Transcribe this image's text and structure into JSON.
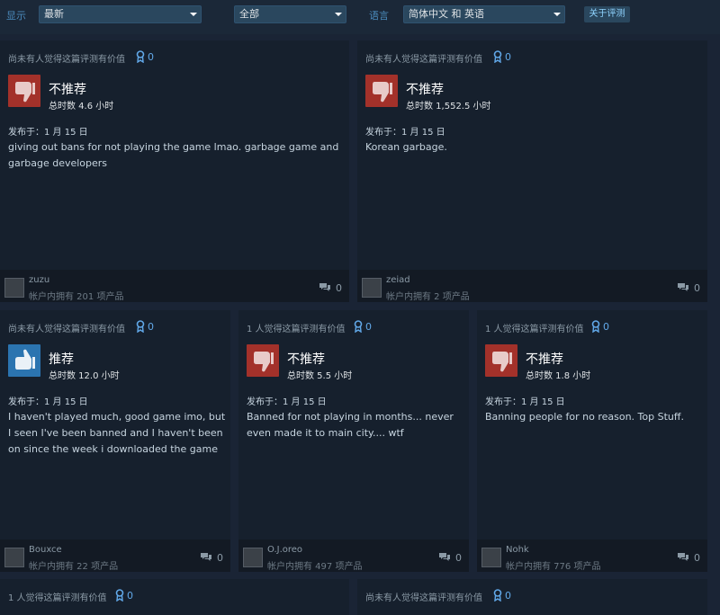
{
  "filters": {
    "show_label": "显示",
    "sort_value": "最新",
    "type_value": "全部",
    "language_label": "语言",
    "language_value": "简体中文 和 英语",
    "about_button": "关于评测"
  },
  "reviews": [
    {
      "helpful": "尚未有人觉得这篇评测有价值",
      "awards": "0",
      "verdict": "不推荐",
      "recommended": false,
      "hours": "总时数 4.6 小时",
      "posted": "发布于：1 月 15 日",
      "text": "giving out bans for not playing the game lmao. garbage game and garbage developers",
      "user": "zuzu",
      "products": "帐户内拥有 201 项产品",
      "comments": "0"
    },
    {
      "helpful": "尚未有人觉得这篇评测有价值",
      "awards": "0",
      "verdict": "不推荐",
      "recommended": false,
      "hours": "总时数 1,552.5 小时",
      "posted": "发布于：1 月 15 日",
      "text": "Korean garbage.",
      "user": "zeiad",
      "products": "帐户内拥有 2 项产品",
      "comments": "0"
    },
    {
      "helpful": "尚未有人觉得这篇评测有价值",
      "awards": "0",
      "verdict": "推荐",
      "recommended": true,
      "hours": "总时数 12.0 小时",
      "posted": "发布于：1 月 15 日",
      "text": "I haven't played much, good game imo, but I seen I've been banned and I haven't been on since the week i downloaded the game",
      "user": "Bouxce",
      "products": "帐户内拥有 22 项产品",
      "comments": "0"
    },
    {
      "helpful": "1 人觉得这篇评测有价值",
      "awards": "0",
      "verdict": "不推荐",
      "recommended": false,
      "hours": "总时数 5.5 小时",
      "posted": "发布于：1 月 15 日",
      "text": "Banned for not playing in months... never even made it to main city.... wtf",
      "user": "O.J.oreo",
      "products": "帐户内拥有 497 项产品",
      "comments": "0"
    },
    {
      "helpful": "1 人觉得这篇评测有价值",
      "awards": "0",
      "verdict": "不推荐",
      "recommended": false,
      "hours": "总时数 1.8 小时",
      "posted": "发布于：1 月 15 日",
      "text": "Banning people for no reason. Top Stuff.",
      "user": "Nohk",
      "products": "帐户内拥有 776 项产品",
      "comments": "0"
    },
    {
      "helpful": "1 人觉得这篇评测有价值",
      "awards": "0"
    },
    {
      "helpful": "尚未有人觉得这篇评测有价值",
      "awards": "0"
    }
  ],
  "colors": {
    "page_bg": "#1a2435",
    "card_bg": "#16202d",
    "negative": "#a3312a",
    "positive": "#2b74b0",
    "accent": "#61a8e8"
  },
  "icons": {
    "award": "award-ribbon-icon",
    "thumbs_down": "thumbs-down-icon",
    "thumbs_up": "thumbs-up-icon",
    "comment": "comment-bubble-icon"
  }
}
